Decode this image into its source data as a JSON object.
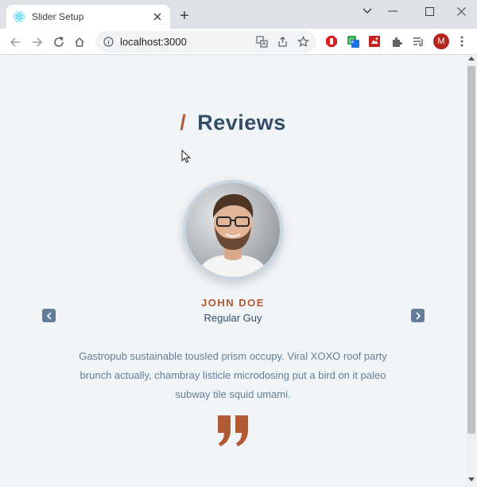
{
  "browser": {
    "tab_title": "Slider Setup",
    "new_tab_label": "+",
    "url": "localhost:3000",
    "profile_initial": "M"
  },
  "section": {
    "title_prefix": "/",
    "title": "Reviews"
  },
  "review": {
    "name": "JOHN DOE",
    "job": "Regular Guy",
    "text": "Gastropub sustainable tousled prism occupy. Viral XOXO roof party brunch actually, chambray listicle microdosing put a bird on it paleo subway tile squid umami.",
    "image_alt": "john doe"
  },
  "colors": {
    "accent": "#b25a34",
    "heading": "#324d67",
    "body_text": "#617d98",
    "background": "#f1f5f8",
    "nav_button": "#617d98"
  },
  "icons": {
    "favicon": "react-logo-icon",
    "prev": "chevron-left-icon",
    "next": "chevron-right-icon",
    "quote": "quote-icon"
  }
}
